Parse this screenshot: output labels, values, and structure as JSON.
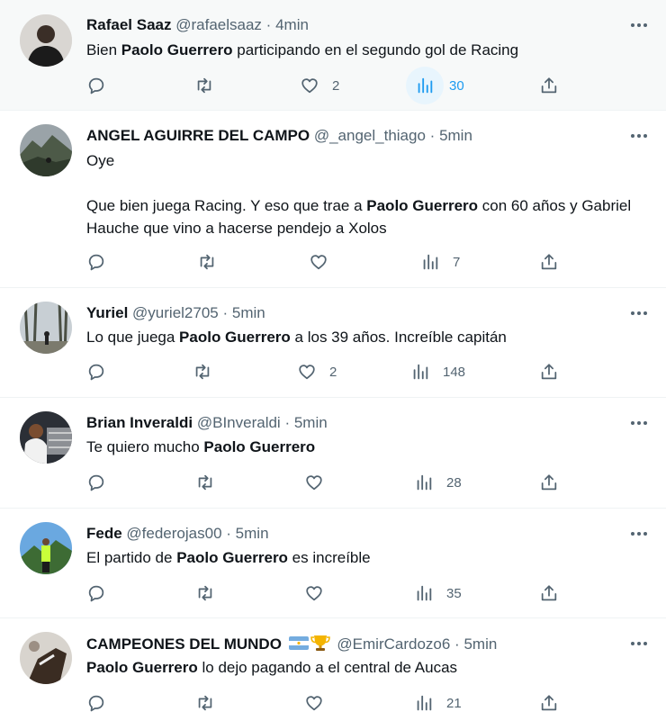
{
  "tweets": [
    {
      "name": "Rafael Saaz",
      "handle": "@rafaelsaaz",
      "dot": "·",
      "time": "4min",
      "text_parts": [
        "Bien ",
        "Paolo Guerrero",
        " participando en el segundo gol de Racing"
      ],
      "likes": "2",
      "views": "30"
    },
    {
      "name": "ANGEL AGUIRRE DEL CAMPO",
      "handle": "@_angel_thiago",
      "dot": "·",
      "time": "5min",
      "line1": "Oye",
      "text_parts": [
        "Que bien juega Racing. Y eso que trae a ",
        "Paolo Guerrero",
        " con 60 años y Gabriel Hauche que vino a hacerse pendejo a Xolos"
      ],
      "views": "7"
    },
    {
      "name": "Yuriel",
      "handle": "@yuriel2705",
      "dot": "·",
      "time": "5min",
      "text_parts": [
        "Lo que juega ",
        "Paolo Guerrero",
        " a los 39 años. Increíble capitán"
      ],
      "likes": "2",
      "views": "148"
    },
    {
      "name": "Brian Inveraldi",
      "handle": "@BInveraldi",
      "dot": "·",
      "time": "5min",
      "text_parts": [
        "Te quiero mucho ",
        "Paolo Guerrero",
        ""
      ],
      "views": "28"
    },
    {
      "name": "Fede",
      "handle": "@federojas00",
      "dot": "·",
      "time": "5min",
      "text_parts": [
        "El partido de ",
        "Paolo Guerrero",
        " es increíble"
      ],
      "views": "35"
    },
    {
      "name": "CAMPEONES DEL MUNDO",
      "name_emoji": [
        "argentina-flag-icon",
        "trophy-icon"
      ],
      "handle": "@EmirCardozo6",
      "dot": "·",
      "time": "5min",
      "text_parts": [
        "",
        "Paolo Guerrero",
        " lo dejo pagando a el central de Aucas"
      ],
      "views": "21"
    }
  ],
  "icons": {
    "reply": "reply-icon",
    "retweet": "retweet-icon",
    "like": "like-icon",
    "views": "views-icon",
    "share": "share-icon",
    "more": "more-icon"
  },
  "colors": {
    "accent": "#1d9bf0",
    "secondary_text": "#536471",
    "divider": "#eff3f4",
    "highlight_bg": "#f7f9f9"
  }
}
